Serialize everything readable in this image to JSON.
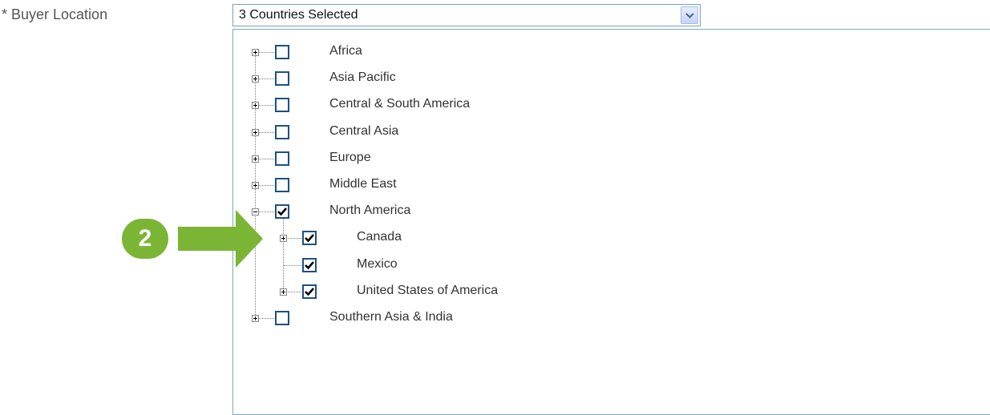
{
  "field": {
    "label": "* Buyer Location",
    "selected_text": "3 Countries Selected",
    "dropdown_icon": "chevron-down-icon"
  },
  "tree": {
    "nodes": [
      {
        "label": "Africa",
        "checked": false,
        "expandable": true,
        "expanded": false,
        "level": 0
      },
      {
        "label": "Asia Pacific",
        "checked": false,
        "expandable": true,
        "expanded": false,
        "level": 0
      },
      {
        "label": "Central & South America",
        "checked": false,
        "expandable": true,
        "expanded": false,
        "level": 0
      },
      {
        "label": "Central Asia",
        "checked": false,
        "expandable": true,
        "expanded": false,
        "level": 0
      },
      {
        "label": "Europe",
        "checked": false,
        "expandable": true,
        "expanded": false,
        "level": 0
      },
      {
        "label": "Middle East",
        "checked": false,
        "expandable": true,
        "expanded": false,
        "level": 0
      },
      {
        "label": "North America",
        "checked": true,
        "expandable": true,
        "expanded": true,
        "level": 0
      },
      {
        "label": "Canada",
        "checked": true,
        "expandable": true,
        "expanded": false,
        "level": 1
      },
      {
        "label": "Mexico",
        "checked": true,
        "expandable": false,
        "expanded": false,
        "level": 1
      },
      {
        "label": "United States of America",
        "checked": true,
        "expandable": true,
        "expanded": false,
        "level": 1
      },
      {
        "label": "Southern Asia & India",
        "checked": false,
        "expandable": true,
        "expanded": false,
        "level": 0
      }
    ]
  },
  "callout": {
    "step_number": "2",
    "color": "#7ab535"
  },
  "colors": {
    "checkbox_border": "#1c5180",
    "panel_border": "#7aabb8",
    "select_border": "#7f9db9"
  }
}
